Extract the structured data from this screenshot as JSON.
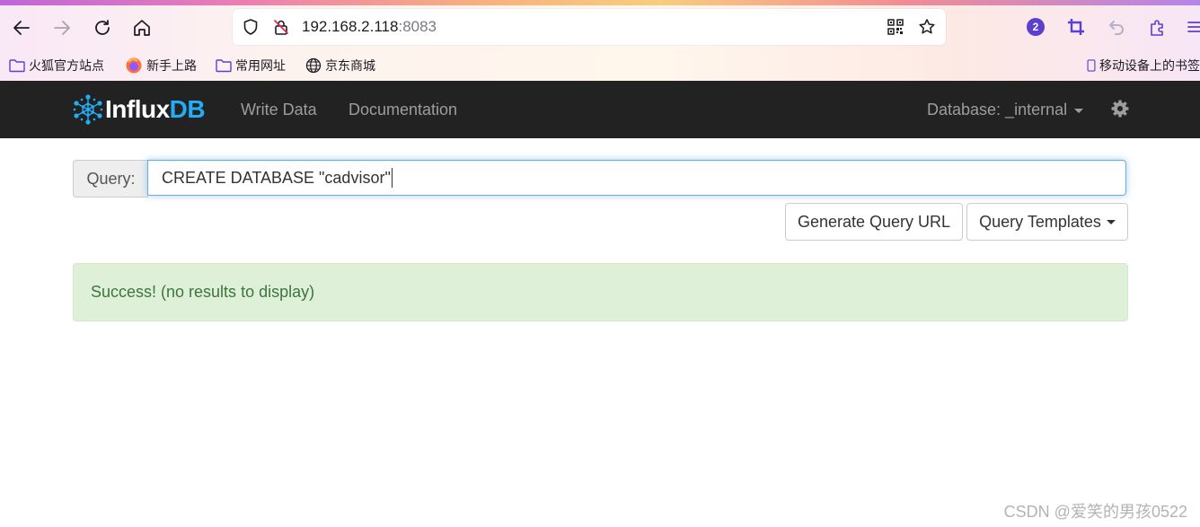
{
  "browser": {
    "url_host": "192.168.2.118",
    "url_port": ":8083",
    "extensions_badge": "2",
    "bookmarks": [
      {
        "label": "火狐官方站点",
        "icon": "folder-icon"
      },
      {
        "label": "新手上路",
        "icon": "firefox-icon"
      },
      {
        "label": "常用网址",
        "icon": "folder-icon"
      },
      {
        "label": "京东商城",
        "icon": "globe-icon"
      }
    ],
    "mobile_bookmarks": "移动设备上的书签"
  },
  "navbar": {
    "brand_influx": "Influx",
    "brand_db": "DB",
    "write_data": "Write Data",
    "documentation": "Documentation",
    "database_label": "Database: _internal",
    "settings_icon": "gear-icon"
  },
  "query": {
    "label": "Query:",
    "value": "CREATE DATABASE \"cadvisor\""
  },
  "buttons": {
    "generate_url": "Generate Query URL",
    "templates": "Query Templates"
  },
  "alert": {
    "text": "Success! (no results to display)",
    "color": "#3c763d"
  },
  "watermark": "CSDN @爱笑的男孩0522",
  "colors": {
    "navbar_bg": "#222222",
    "brand_accent": "#22adf6",
    "alert_bg": "#dff0d8"
  }
}
